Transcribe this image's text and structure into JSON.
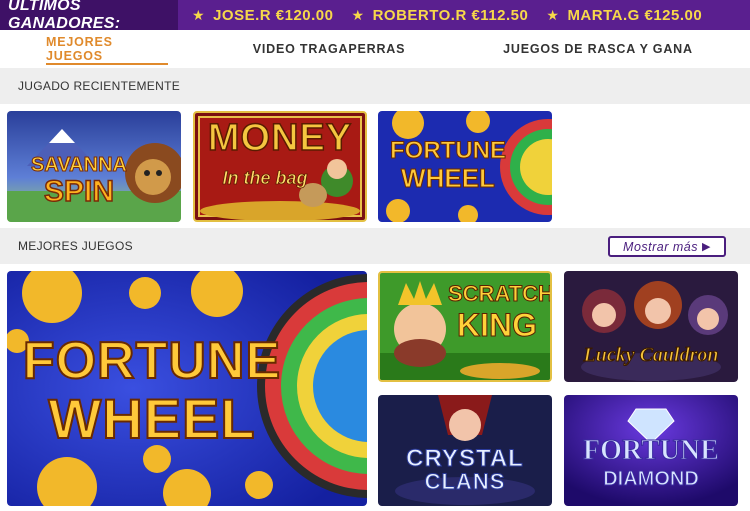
{
  "ticker": {
    "title": "ÚLTIMOS GANADORES:",
    "winners": [
      {
        "name": "JOSE.R",
        "amount": "€120.00"
      },
      {
        "name": "ROBERTO.R",
        "amount": "€112.50"
      },
      {
        "name": "MARTA.G",
        "amount": "€125.00"
      }
    ],
    "icon": "star-icon"
  },
  "tabs": [
    {
      "label": "MEJORES JUEGOS",
      "active": true
    },
    {
      "label": "VIDEO TRAGAPERRAS",
      "active": false
    },
    {
      "label": "JUEGOS DE RASCA Y GANA",
      "active": false
    }
  ],
  "recent": {
    "title": "JUGADO RECIENTEMENTE",
    "games": [
      {
        "line1": "SAVANNA",
        "line2": "SPIN"
      },
      {
        "line1": "MONEY",
        "line2": "In the bag"
      },
      {
        "line1": "FORTUNE",
        "line2": "WHEEL"
      }
    ]
  },
  "best": {
    "title": "MEJORES JUEGOS",
    "more_label": "Mostrar más",
    "more_icon": "play-arrow-icon",
    "featured": {
      "line1": "FORTUNE",
      "line2": "WHEEL"
    },
    "games": [
      {
        "line1": "SCRATCH",
        "line2": "KING"
      },
      {
        "line1": "Lucky Cauldron",
        "line2": ""
      },
      {
        "line1": "CRYSTAL",
        "line2": "CLANS"
      },
      {
        "line1": "FORTUNE",
        "line2": "DIAMOND"
      }
    ]
  },
  "colors": {
    "ticker_bg": "#5a1f8f",
    "ticker_title_bg": "#3e1166",
    "gold": "#f7d84a",
    "accent": "#e08a2c",
    "purple": "#4a1e7e"
  }
}
